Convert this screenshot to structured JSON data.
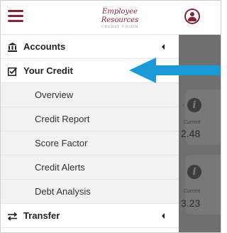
{
  "header": {
    "logo_text": "Employee Resources",
    "logo_subtext": "CREDIT UNION",
    "menu_icon": "hamburger-icon",
    "profile_icon": "user-circle-icon",
    "brand_color": "#8c2035"
  },
  "nav": {
    "items": [
      {
        "label": "Accounts",
        "icon": "bank-icon",
        "expandable": true
      },
      {
        "label": "Your Credit",
        "icon": "checked-box-icon",
        "expanded": true,
        "children": [
          {
            "label": "Overview"
          },
          {
            "label": "Credit Report"
          },
          {
            "label": "Score Factor"
          },
          {
            "label": "Credit Alerts"
          },
          {
            "label": "Debt Analysis"
          }
        ]
      },
      {
        "label": "Transfer",
        "icon": "transfer-arrows-icon",
        "expandable": true
      }
    ]
  },
  "background_cards": [
    {
      "caption": "Current",
      "value": "2.48",
      "icon": "info-icon"
    },
    {
      "caption": "Current",
      "value": "3.23",
      "icon": "info-icon"
    }
  ],
  "annotation": {
    "arrow_color": "#1a9ad6",
    "points_to": "Your Credit"
  }
}
